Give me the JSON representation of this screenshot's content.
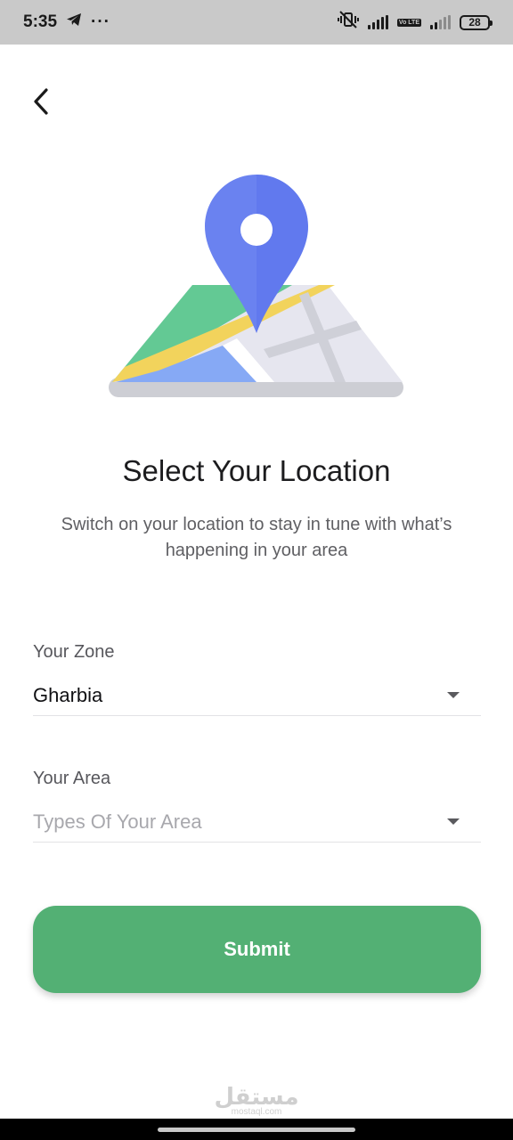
{
  "status_bar": {
    "time": "5:35",
    "more": "···",
    "volte": "Vo LTE",
    "battery": "28"
  },
  "header": {
    "back_icon": "chevron-left-icon"
  },
  "illustration": {
    "icon": "map-pin-icon",
    "colors": {
      "pin": "#6a82f0",
      "pin_dark": "#4c63e6",
      "map_green": "#63c994",
      "map_yellow": "#f2d35c",
      "map_blue": "#86a9f5",
      "map_light": "#e6e6ef",
      "map_base": "#cdced4"
    }
  },
  "main": {
    "title": "Select Your Location",
    "subtitle": "Switch on your location to stay in tune with what’s happening in your area"
  },
  "form": {
    "zone": {
      "label": "Your Zone",
      "value": "Gharbia"
    },
    "area": {
      "label": "Your Area",
      "placeholder": "Types Of Your Area"
    },
    "submit_label": "Submit"
  },
  "watermark": {
    "arabic": "مستقل",
    "latin": "mostaql.com"
  },
  "theme": {
    "accent": "#53b074",
    "status_bar_bg": "#c9c9c9"
  }
}
